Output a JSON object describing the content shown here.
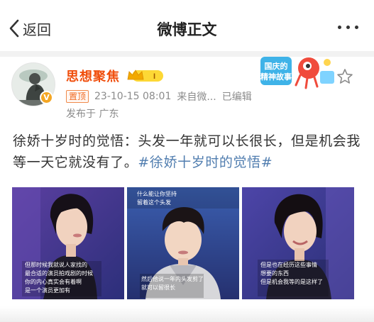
{
  "nav": {
    "back_label": "返回",
    "title": "微博正文",
    "icons": {
      "back": "chevron-left-icon",
      "more": "more-dots-icon"
    }
  },
  "author": {
    "name": "思想聚焦",
    "name_color": "#f04e0c",
    "avatar_icon": "thinker-avatar",
    "verified_icon": "verified-badge-icon",
    "level_icon": "crown-level-icon",
    "level_badge_text": "I"
  },
  "meta": {
    "pinned": "置顶",
    "timestamp": "23-10-15 08:01",
    "source": "来自微...",
    "edited": "已编辑",
    "location": "发布于 广东"
  },
  "promo": {
    "text_top": "国庆的",
    "text_bottom": "精神故事"
  },
  "post": {
    "text": "徐娇十岁时的觉悟：头发一年就可以长很长，但是机会我等一天它就没有了。",
    "hashtag": "#徐娇十岁时的觉悟#",
    "hashtag_color": "#507daf"
  },
  "images": [
    {
      "subject": "woman-short-hair",
      "subs": [
        "但那时候我就说人家找的",
        "最合适的演员拍戏剧的时候",
        "你的内心真实会有着啊",
        "是一个演员更加有"
      ]
    },
    {
      "subject": "young-boy",
      "header": [
        "什么能让你坚持",
        "留着这个头发"
      ],
      "subs": [
        "然后他说一年内头发剪了",
        "就可以留很长"
      ]
    },
    {
      "subject": "woman-short-hair-smiling",
      "subs": [
        "但是也在经历这些事情",
        "想要的东西",
        "但是机会我等的是这样了"
      ]
    }
  ]
}
